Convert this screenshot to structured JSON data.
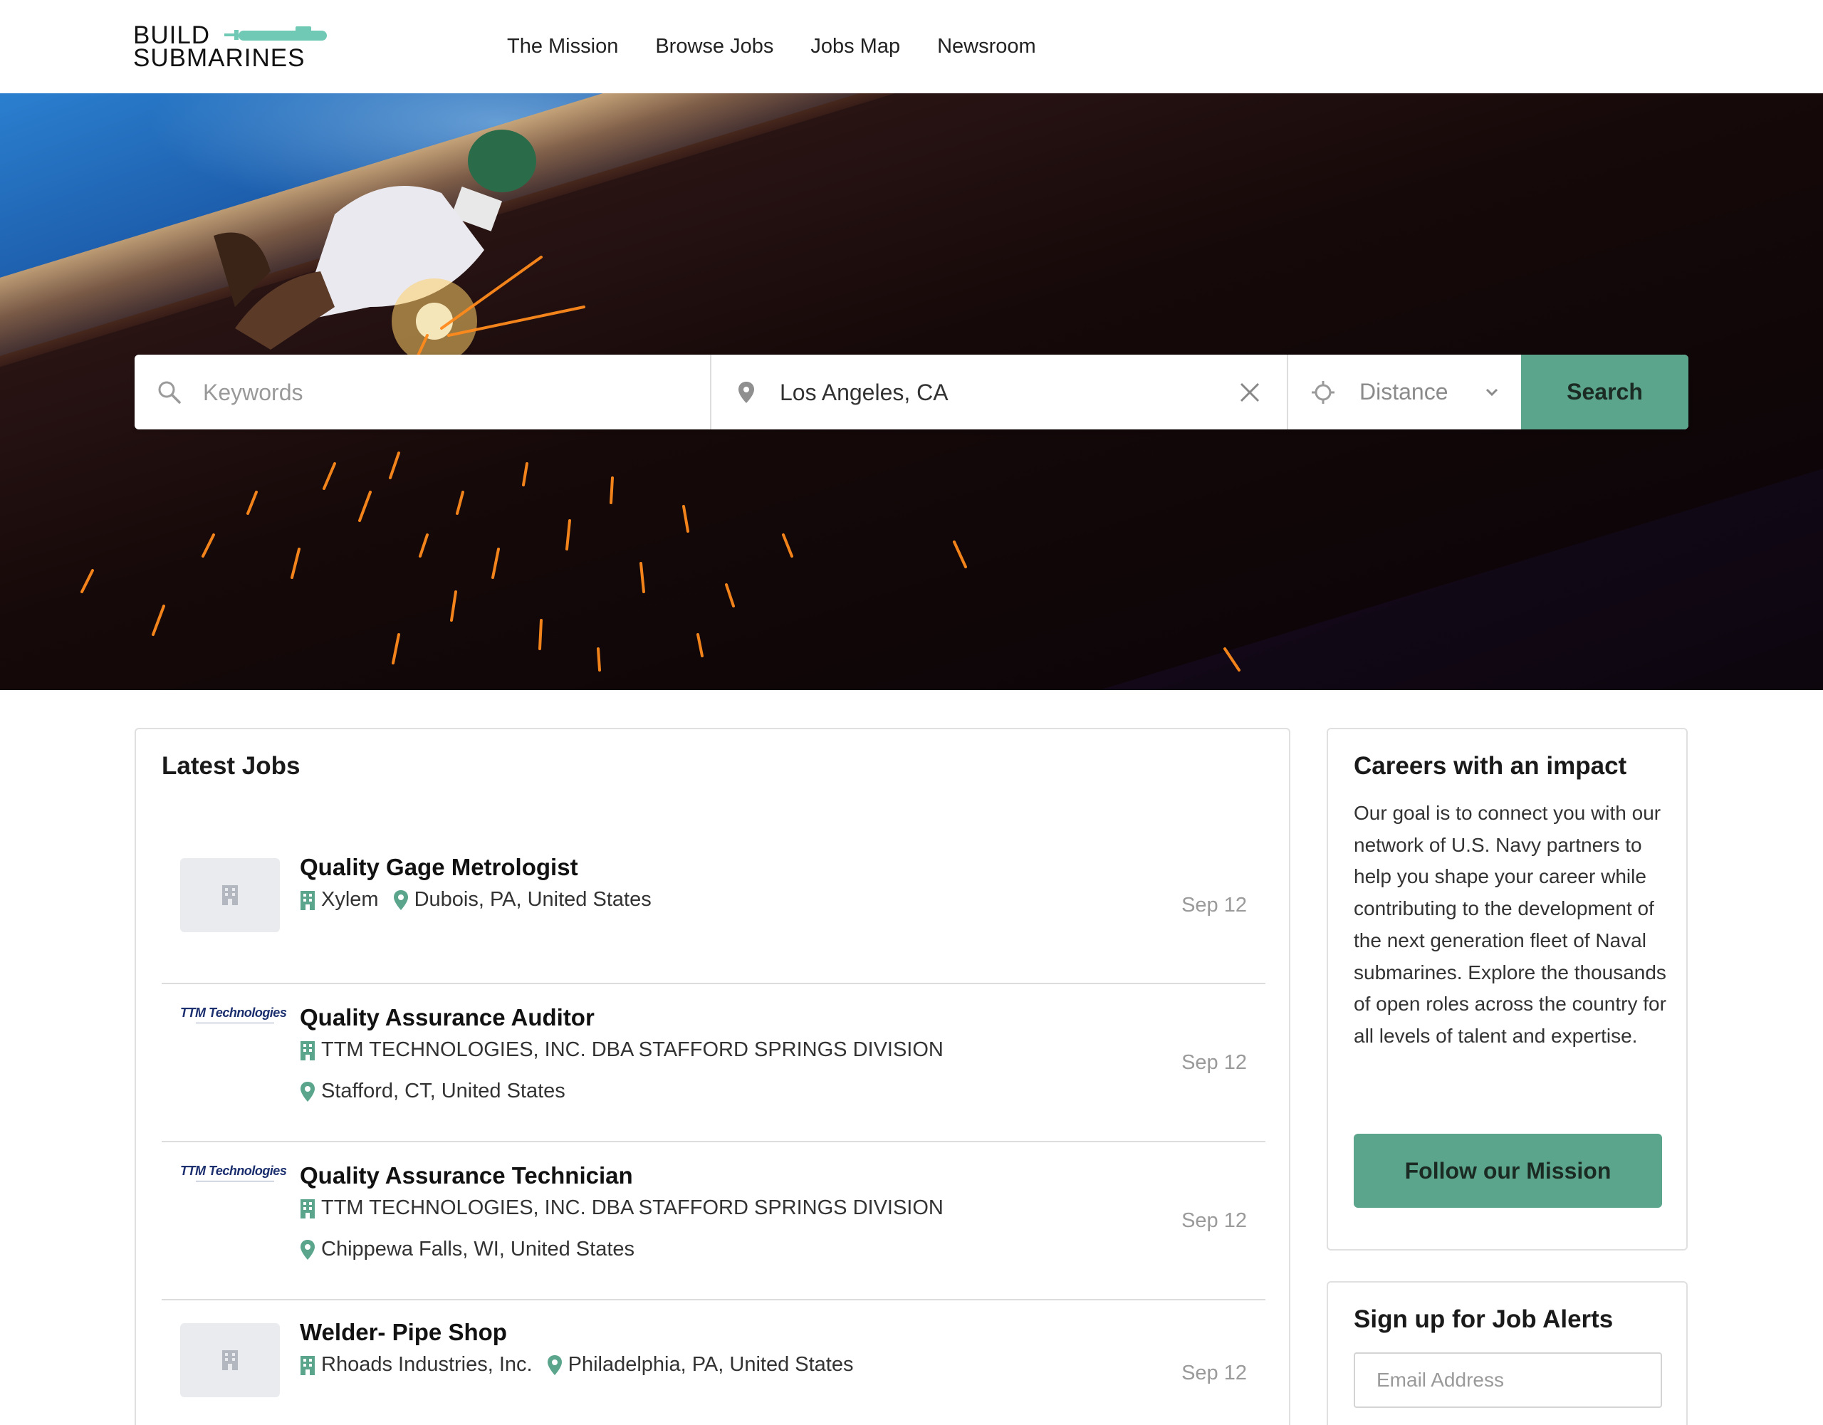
{
  "header": {
    "logo": {
      "line1": "BUILD",
      "line2": "SUBMARINES"
    },
    "nav": [
      "The Mission",
      "Browse Jobs",
      "Jobs Map",
      "Newsroom"
    ]
  },
  "search": {
    "keywords_placeholder": "Keywords",
    "location_value": "Los Angeles, CA",
    "distance_label": "Distance",
    "button_label": "Search"
  },
  "latest_jobs": {
    "title": "Latest Jobs",
    "jobs": [
      {
        "title": "Quality Gage Metrologist",
        "company": "Xylem",
        "location": "Dubois, PA, United States",
        "date": "Sep 12",
        "logo": "placeholder"
      },
      {
        "title": "Quality Assurance Auditor",
        "company": "TTM TECHNOLOGIES, INC. DBA STAFFORD SPRINGS DIVISION",
        "location": "Stafford, CT, United States",
        "date": "Sep 12",
        "logo": "TTM Technologies"
      },
      {
        "title": "Quality Assurance Technician",
        "company": "TTM TECHNOLOGIES, INC. DBA STAFFORD SPRINGS DIVISION",
        "location": "Chippewa Falls, WI, United States",
        "date": "Sep 12",
        "logo": "TTM Technologies"
      },
      {
        "title": "Welder- Pipe Shop",
        "company": "Rhoads Industries, Inc.",
        "location": "Philadelphia, PA, United States",
        "date": "Sep 12",
        "logo": "placeholder"
      }
    ]
  },
  "sidebar": {
    "careers": {
      "title": "Careers with an impact",
      "body": "Our goal is to connect you with our network of U.S. Navy partners to help you shape your career while contributing to the development of the next generation fleet of Naval submarines. Explore the thousands of open roles across the country for all levels of talent and expertise.",
      "button_label": "Follow our Mission"
    },
    "alerts": {
      "title": "Sign up for Job Alerts",
      "email_placeholder": "Email Address"
    }
  },
  "colors": {
    "accent": "#5ba58c",
    "icon_teal": "#5ba58c",
    "logo_sub": "#6fc9b4"
  }
}
